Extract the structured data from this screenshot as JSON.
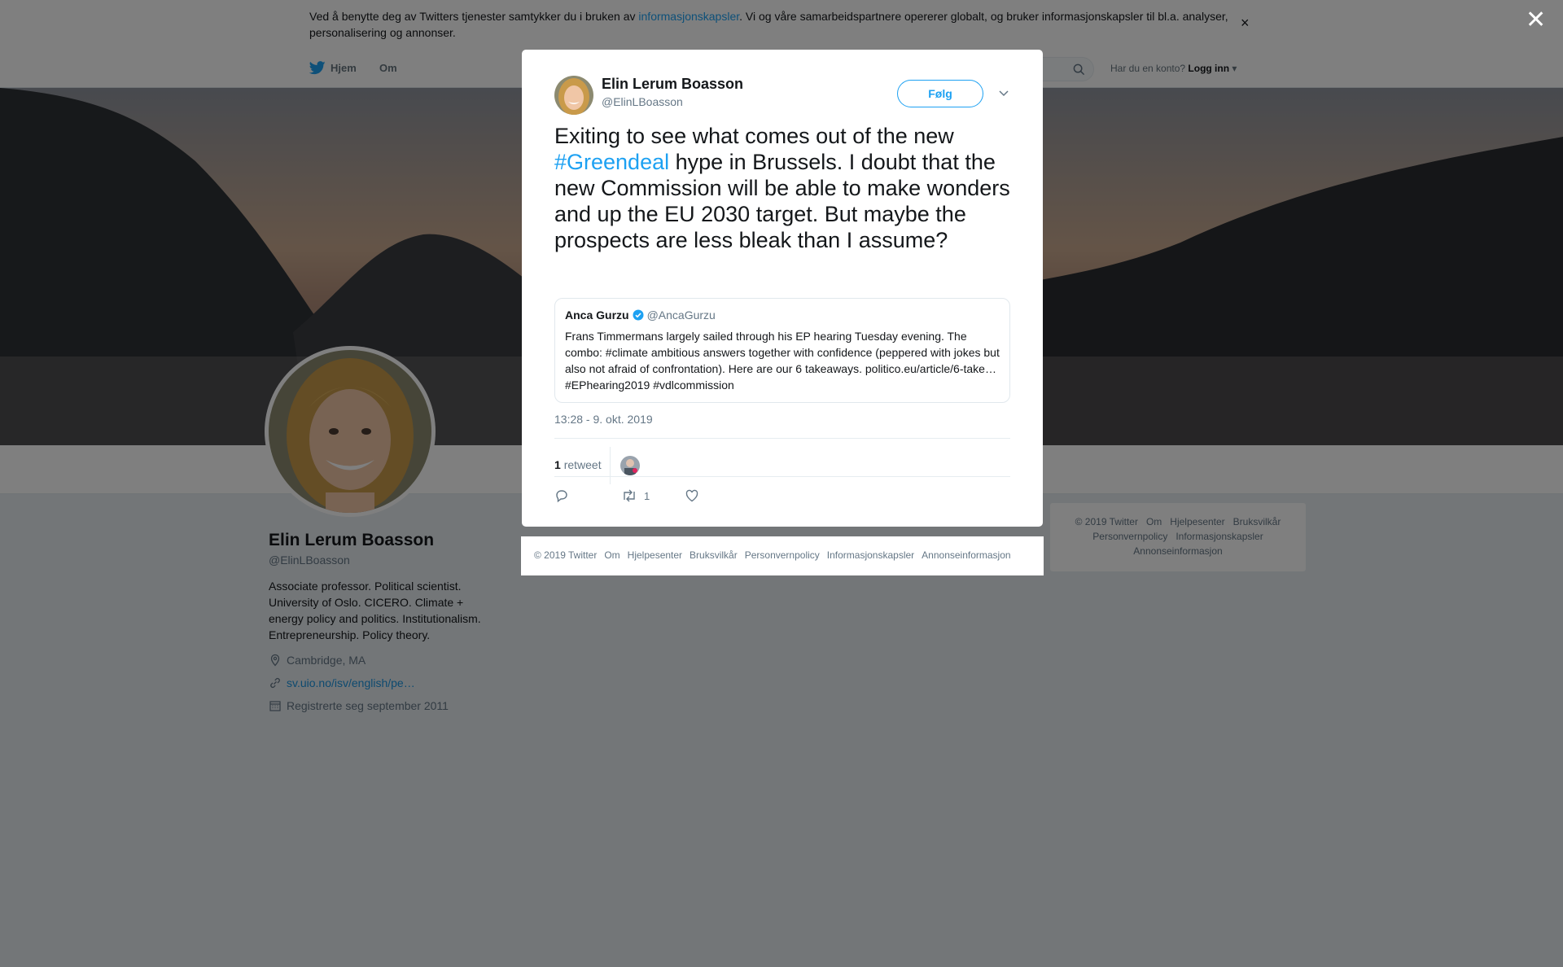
{
  "cookie_banner": {
    "text_before": "Ved å benytte deg av Twitters tjenester samtykker du i bruken av ",
    "link": "informasjonskapsler",
    "text_after": ". Vi og våre samarbeidspartnere opererer globalt, og bruker informasjonskapsler til bl.a. analyser, personalisering og annonser.",
    "close": "×"
  },
  "nav": {
    "home": "Hjem",
    "about": "Om",
    "account_prompt": "Har du en konto?",
    "login": "Logg inn"
  },
  "profile": {
    "name": "Elin Lerum Boasson",
    "handle": "@ElinLBoasson",
    "bio": "Associate professor. Political scientist. University of Oslo. CICERO. Climate + energy policy and politics. Institutionalism. Entrepreneurship. Policy theory.",
    "location": "Cambridge, MA",
    "url": "sv.uio.no/isv/english/pe…",
    "joined": "Registrerte seg september 2011"
  },
  "right_footer": {
    "copyright": "© 2019 Twitter",
    "links": [
      "Om",
      "Hjelpesenter",
      "Bruksvilkår",
      "Personvernpolicy",
      "Informasjonskapsler",
      "Annonseinformasjon"
    ]
  },
  "overlay": {
    "close": "✕"
  },
  "tweet": {
    "author_name": "Elin Lerum Boasson",
    "author_handle": "@ElinLBoasson",
    "follow_label": "Følg",
    "text_before": "Exiting to see what comes out of the new ",
    "hashtag": "#Greendeal",
    "text_after": " hype in Brussels. I doubt that the new Commission will be able to make wonders and up the EU 2030 target. But maybe the prospects are less bleak than I assume?",
    "quoted": {
      "name": "Anca Gurzu",
      "handle": "@AncaGurzu",
      "verified": true,
      "text": "Frans Timmermans largely sailed through his EP hearing Tuesday evening. The combo: #climate ambitious answers together with confidence (peppered with jokes but also not afraid of confrontation). Here are our 6 takeaways. politico.eu/article/6-take… #EPhearing2019 #vdlcommission"
    },
    "timestamp": "13:28 - 9. okt. 2019",
    "retweet_count": "1",
    "retweet_label": "retweet",
    "action_retweet_count": "1"
  },
  "modal_footer": {
    "copyright": "© 2019 Twitter",
    "links": [
      "Om",
      "Hjelpesenter",
      "Bruksvilkår",
      "Personvernpolicy",
      "Informasjonskapsler",
      "Annonseinformasjon"
    ]
  },
  "colors": {
    "accent": "#1da1f2",
    "text": "#14171a",
    "muted": "#657786",
    "background": "#e6ecf0"
  }
}
